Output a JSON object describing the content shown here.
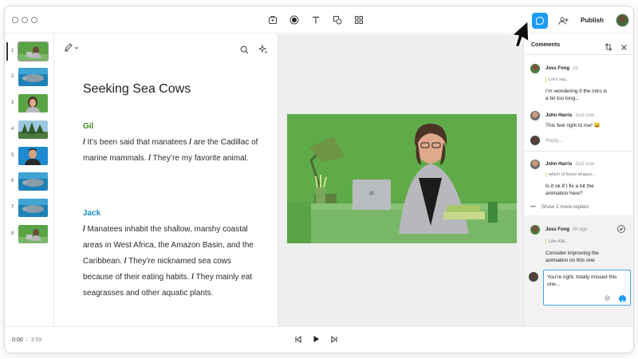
{
  "toolbar": {
    "tools": [
      "export-icon",
      "record-icon",
      "text-icon",
      "shapes-icon",
      "grid-icon"
    ],
    "comment_icon": "comment-icon",
    "add_user_icon": "add-user-icon",
    "publish_label": "Publish"
  },
  "thumbnails": [
    {
      "num": "1",
      "scene": "woman-at-desk"
    },
    {
      "num": "2",
      "scene": "manatee-underwater"
    },
    {
      "num": "3",
      "scene": "woman-portrait"
    },
    {
      "num": "4",
      "scene": "trees"
    },
    {
      "num": "5",
      "scene": "man-portrait"
    },
    {
      "num": "6",
      "scene": "manatee-underwater"
    },
    {
      "num": "7",
      "scene": "manatee-underwater"
    },
    {
      "num": "8",
      "scene": "woman-at-desk"
    }
  ],
  "script": {
    "title": "Seeking Sea Cows",
    "blocks": [
      {
        "speaker": "Gil",
        "color": "#3d8a1f",
        "text": "/ It’s been said that manatees / are the Cadillac of marine mammals. / They’re my favorite animal."
      },
      {
        "speaker": "Jack",
        "color": "#1f8ac2",
        "text": "/ Manatees inhabit the shallow, marshy coastal areas in West Africa, the Amazon Basin, and the Caribbean. / They’re nicknamed sea cows because of their eating habits. / They mainly eat seagrasses and other aquatic plants."
      }
    ]
  },
  "comments": {
    "header": "Comments",
    "threads": [
      {
        "author": "Joss Fong",
        "time": "2d",
        "quote": "Let’s say...",
        "text": "I’m wondering if the intro is a bit too long...",
        "reply": {
          "author": "John Harris",
          "time": "Just now",
          "text": "This feel right to me! 😄"
        },
        "reply_placeholder": "Reply..."
      },
      {
        "author": "John Harris",
        "time": "Just now",
        "quote": "which of these shapes...",
        "text": "Is it ok if I fix a bit the animation here?",
        "more_replies": "Show 2 more replies"
      },
      {
        "author": "Joss Fong",
        "time": "4h ago",
        "quote": "Like Kiki...",
        "text": "Consider improving the animation on this one",
        "draft": "You’re right, totally missed this one..."
      }
    ]
  },
  "player": {
    "current": "0:00",
    "separator": "/",
    "total": "3:59"
  },
  "colors": {
    "accent": "#1a9bf4",
    "gil": "#3d8a1f",
    "jack": "#1f8ac2",
    "video_bg": "#5aa445"
  }
}
